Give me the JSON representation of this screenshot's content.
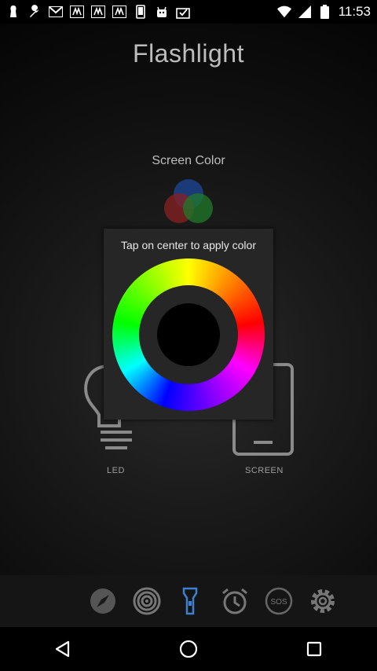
{
  "status_bar": {
    "time": "11:53",
    "left_icons": [
      "notification-icon",
      "wrench-icon",
      "gmail-icon",
      "app-icon",
      "app-icon",
      "app-icon",
      "phone-icon",
      "android-icon",
      "download-icon"
    ],
    "right_icons": [
      "wifi-icon",
      "signal-icon",
      "battery-icon"
    ]
  },
  "app": {
    "title": "Flashlight",
    "screen_color_label": "Screen Color",
    "led_label": "LED",
    "screen_label": "SCREEN"
  },
  "dialog": {
    "title": "Tap on center to apply color",
    "selected_color": "#000000"
  },
  "toolbar": {
    "items": [
      "compass-icon",
      "target-icon",
      "flashlight-icon",
      "alarm-clock-icon",
      "sos-icon",
      "settings-icon"
    ],
    "sos_text": "SOS",
    "active_color": "#3f7fcf"
  },
  "navbar": {
    "items": [
      "back-icon",
      "home-icon",
      "recents-icon"
    ]
  }
}
